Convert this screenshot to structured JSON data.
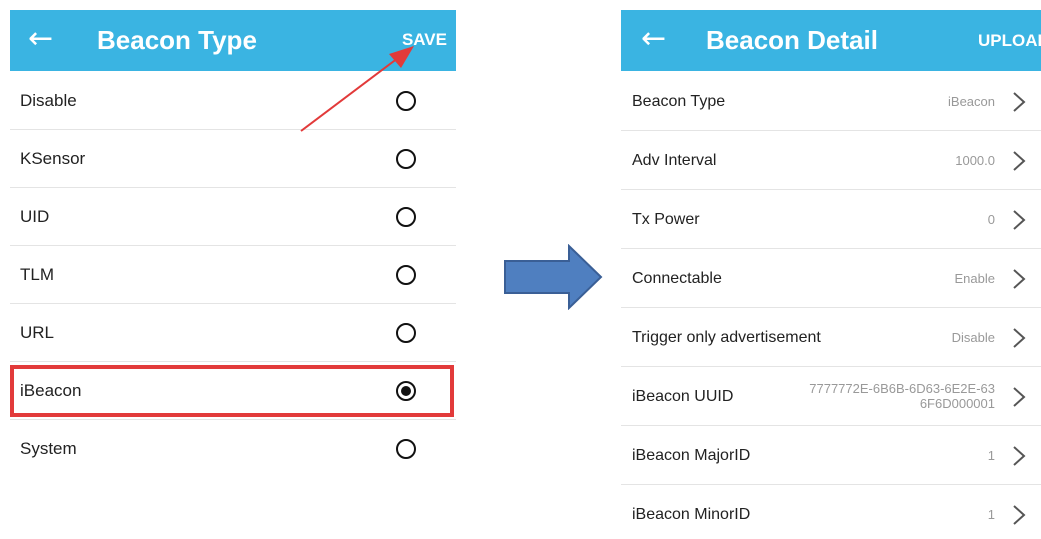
{
  "left_screen": {
    "back_glyph": "←",
    "title": "Beacon Type",
    "action": "SAVE",
    "options": [
      {
        "label": "Disable",
        "checked": false
      },
      {
        "label": "KSensor",
        "checked": false
      },
      {
        "label": "UID",
        "checked": false
      },
      {
        "label": "TLM",
        "checked": false
      },
      {
        "label": "URL",
        "checked": false
      },
      {
        "label": "iBeacon",
        "checked": true
      },
      {
        "label": "System",
        "checked": false
      }
    ]
  },
  "right_screen": {
    "back_glyph": "←",
    "title": "Beacon Detail",
    "action": "UPLOAD",
    "rows": [
      {
        "label": "Beacon Type",
        "value": "iBeacon"
      },
      {
        "label": "Adv Interval",
        "value": "1000.0"
      },
      {
        "label": "Tx Power",
        "value": "0"
      },
      {
        "label": "Connectable",
        "value": "Enable"
      },
      {
        "label": "Trigger only advertisement",
        "value": "Disable"
      },
      {
        "label": "iBeacon UUID",
        "value_line1": "7777772E-6B6B-6D63-6E2E-63",
        "value_line2": "6F6D000001"
      },
      {
        "label": "iBeacon MajorID",
        "value": "1"
      },
      {
        "label": "iBeacon MinorID",
        "value": "1"
      }
    ]
  },
  "colors": {
    "appbar": "#3ab4e2",
    "highlight": "#e23a3a",
    "flow_arrow": "#4f7fc0",
    "flow_arrow_border": "#3a5f96"
  },
  "icons": {
    "back": "arrow-left-icon",
    "row_chevron": "chevron-right-icon",
    "annotation_arrow": "red-pointer-arrow",
    "flow_arrow": "blue-right-arrow"
  }
}
